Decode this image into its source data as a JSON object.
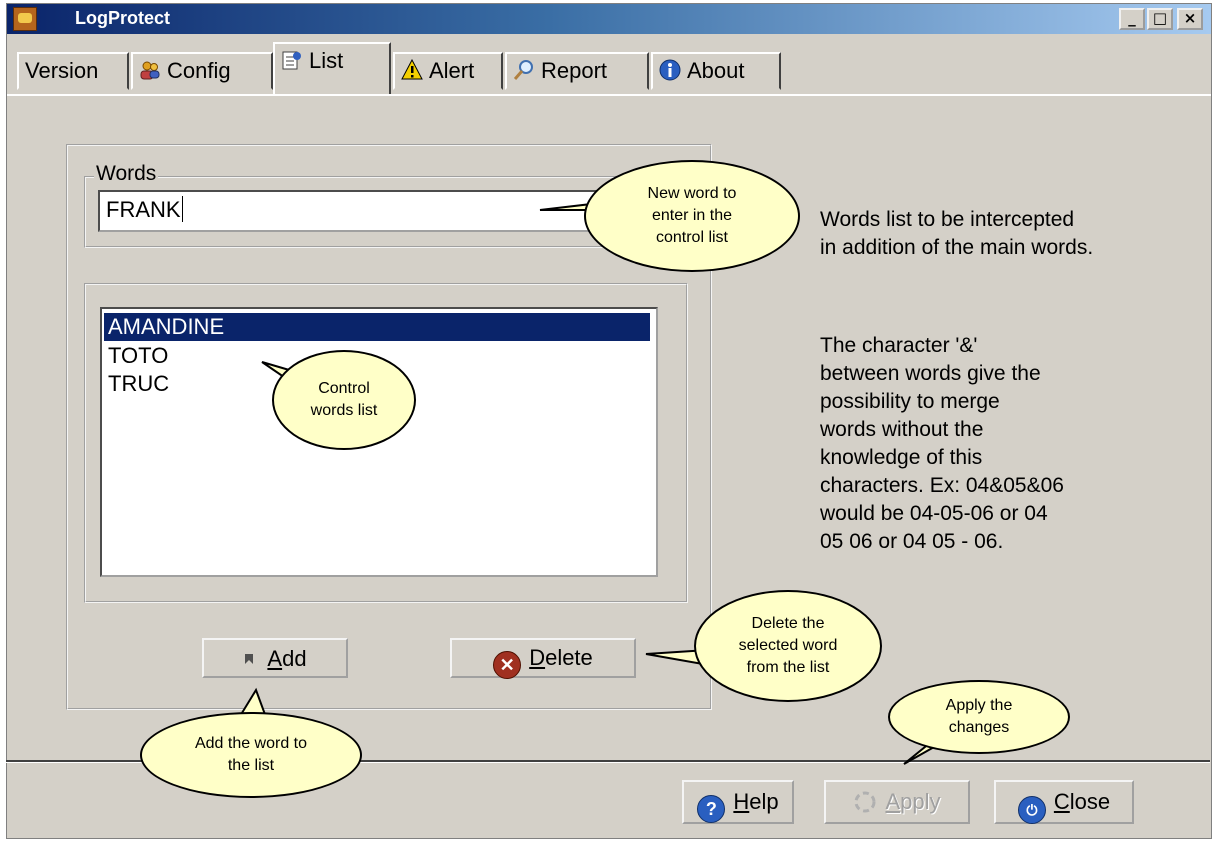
{
  "window": {
    "title": "LogProtect",
    "controls": {
      "minimize": "_",
      "maximize": "□",
      "close": "×"
    }
  },
  "tabs": [
    {
      "label": "Version",
      "icon": "none",
      "active": false
    },
    {
      "label": "Config",
      "icon": "users-icon",
      "active": false
    },
    {
      "label": "List",
      "icon": "list-icon",
      "active": true
    },
    {
      "label": "Alert",
      "icon": "warning-icon",
      "active": false
    },
    {
      "label": "Report",
      "icon": "magnifier-icon",
      "active": false
    },
    {
      "label": "About",
      "icon": "info-icon",
      "active": false
    }
  ],
  "words_group": {
    "legend": "Words",
    "input_value": "FRANK"
  },
  "control_list": {
    "items": [
      "AMANDINE",
      "TOTO",
      "TRUC"
    ],
    "selected_index": 0
  },
  "buttons": {
    "add": {
      "prefix": "",
      "underlined": "A",
      "rest": "dd"
    },
    "delete": {
      "prefix": "",
      "underlined": "D",
      "rest": "elete"
    },
    "help": {
      "underlined": "H",
      "rest": "elp"
    },
    "apply": {
      "underlined": "A",
      "rest": "pply",
      "enabled": false
    },
    "close": {
      "underlined": "C",
      "rest": "lose"
    }
  },
  "info_text": {
    "para1": [
      "Words list to be intercepted",
      "in addition of the main words."
    ],
    "para2": [
      "The character '&'",
      "between words give the",
      "possibility to merge",
      "words without the",
      "knowledge of this",
      "characters. Ex: 04&05&06",
      "would be 04-05-06 or 04",
      "05 06 or 04 05 - 06."
    ]
  },
  "callouts": {
    "new_word": [
      "New word to",
      "enter in the",
      "control list"
    ],
    "control_list": [
      "Control",
      "words list"
    ],
    "delete": [
      "Delete the",
      "selected word",
      "from the list"
    ],
    "apply": [
      "Apply the",
      "changes"
    ],
    "add": [
      "Add the word to",
      "the list"
    ]
  },
  "colors": {
    "window_bg": "#d4d0c8",
    "selection": "#0a246a",
    "callout_bg": "#ffffc8"
  }
}
